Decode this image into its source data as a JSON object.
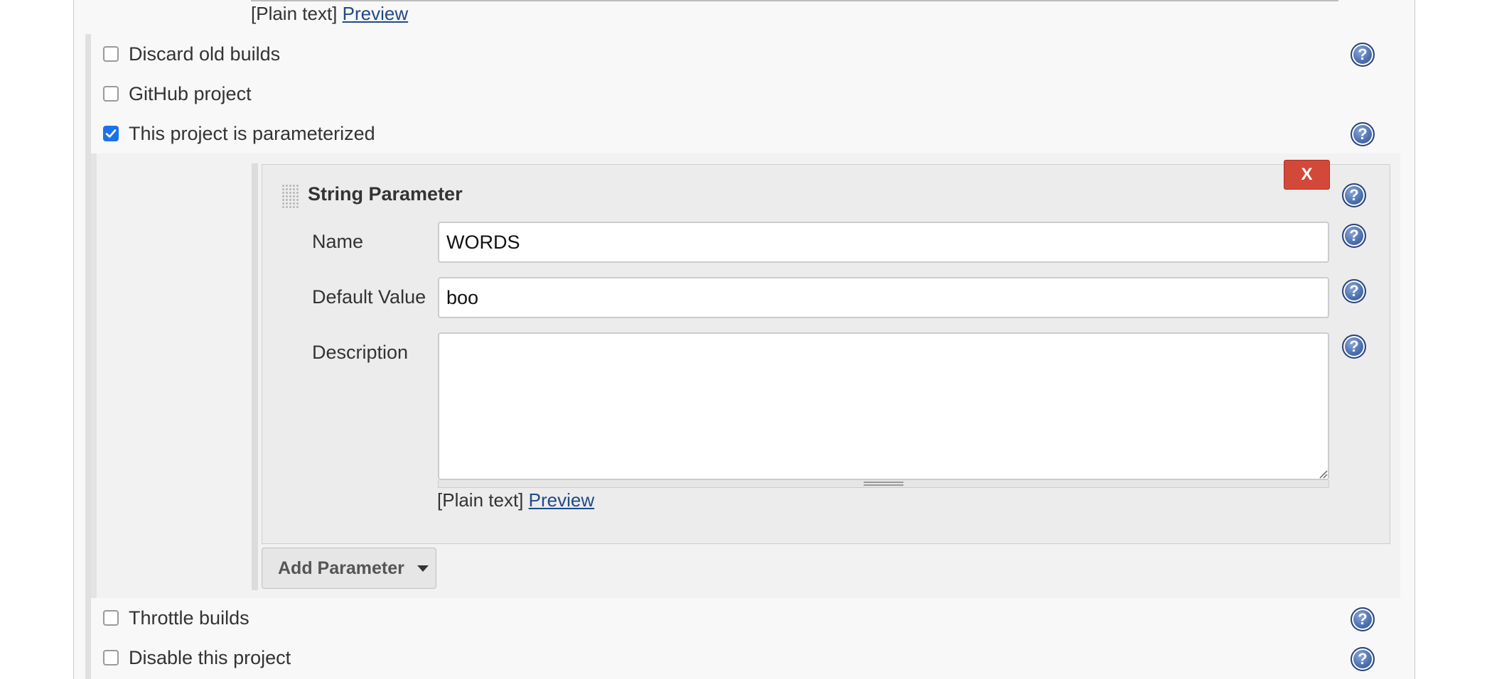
{
  "top_markup": {
    "plain_text": "[Plain text]",
    "preview": "Preview"
  },
  "options": {
    "discard_old_builds": {
      "label": "Discard old builds",
      "checked": false
    },
    "github_project": {
      "label": "GitHub project",
      "checked": false
    },
    "parameterized": {
      "label": "This project is parameterized",
      "checked": true
    },
    "throttle_builds": {
      "label": "Throttle builds",
      "checked": false
    },
    "disable_project": {
      "label": "Disable this project",
      "checked": false
    }
  },
  "string_parameter": {
    "title": "String Parameter",
    "delete_label": "X",
    "name_label": "Name",
    "name_value": "WORDS",
    "default_label": "Default Value",
    "default_value": "boo",
    "description_label": "Description",
    "description_value": "",
    "markup": {
      "plain_text": "[Plain text]",
      "preview": "Preview"
    }
  },
  "add_parameter_label": "Add Parameter",
  "icons": {
    "help": "help-icon",
    "checkbox_checked": "checkmark-icon",
    "drag": "drag-handle-icon",
    "dropdown": "caret-down-icon"
  },
  "colors": {
    "checkbox_accent": "#1a73e8",
    "delete_button": "#d24939",
    "link": "#204a87"
  }
}
